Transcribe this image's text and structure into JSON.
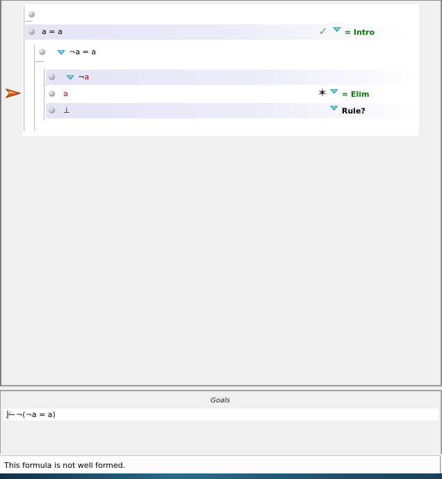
{
  "proof": {
    "lines": [
      {
        "formula": "",
        "rule": ""
      },
      {
        "formula": "a = a",
        "rule": "= Intro",
        "status": "checked"
      },
      {
        "formula": "¬a = a",
        "rule": ""
      },
      {
        "formula": "¬a",
        "rule": ""
      },
      {
        "formula": "a",
        "rule": "= Elim",
        "status": "error"
      },
      {
        "formula": "⊥",
        "rule": "Rule?",
        "status": "pending"
      }
    ]
  },
  "goals": {
    "title": "Goals",
    "items": [
      {
        "formula": "¬(¬a = a)"
      }
    ]
  },
  "status_bar": {
    "message": "This formula is not well formed."
  },
  "colors": {
    "rule_ok": "#0a7a0a",
    "error_text": "#c00000",
    "dropdown": "#3aa8b8",
    "current_line_arrow": "#e05a10"
  }
}
